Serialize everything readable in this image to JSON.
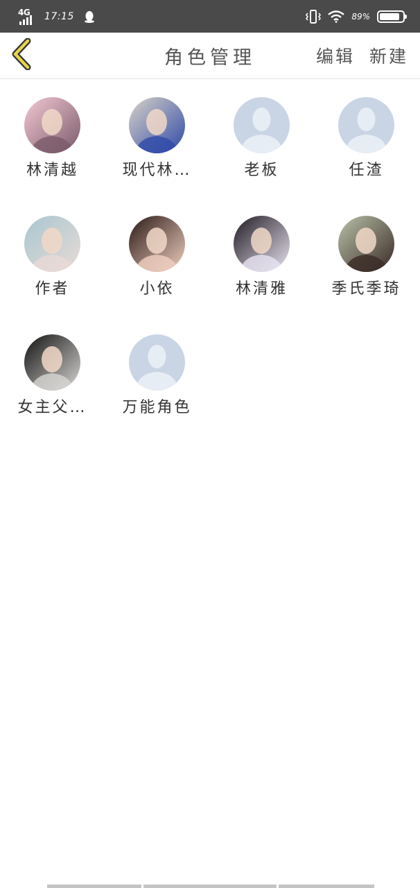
{
  "status_bar": {
    "network": "4G",
    "time": "17:15",
    "battery": "89%",
    "battery_level": 0.89,
    "icons": [
      "qq-icon",
      "vibrate-icon",
      "wifi-icon",
      "battery-icon"
    ]
  },
  "header": {
    "title": "角色管理",
    "edit_label": "编辑",
    "new_label": "新建",
    "back_icon": "chevron-left-icon",
    "accent_color": "#e8d44d"
  },
  "characters": [
    {
      "name": "林清越",
      "avatar": "photo",
      "palette": [
        "#f3c9d4",
        "#7a5a6a"
      ]
    },
    {
      "name": "现代林…",
      "avatar": "photo",
      "palette": [
        "#d9d2c8",
        "#2f4aa8"
      ]
    },
    {
      "name": "老板",
      "avatar": "placeholder"
    },
    {
      "name": "任渣",
      "avatar": "placeholder"
    },
    {
      "name": "作者",
      "avatar": "photo",
      "palette": [
        "#a8c7d0",
        "#e8dad6"
      ]
    },
    {
      "name": "小依",
      "avatar": "photo",
      "palette": [
        "#2b1a16",
        "#f0cfc0"
      ]
    },
    {
      "name": "林清雅",
      "avatar": "photo",
      "palette": [
        "#1f1a22",
        "#e9e4f1"
      ]
    },
    {
      "name": "季氏季琦",
      "avatar": "photo",
      "palette": [
        "#b9c2a9",
        "#3a2a26"
      ]
    },
    {
      "name": "女主父…",
      "avatar": "photo",
      "palette": [
        "#111111",
        "#d8d6d3"
      ]
    },
    {
      "name": "万能角色",
      "avatar": "placeholder"
    }
  ],
  "placeholder_colors": {
    "background": "#c9d5e5",
    "figure": "#e7edf5"
  }
}
